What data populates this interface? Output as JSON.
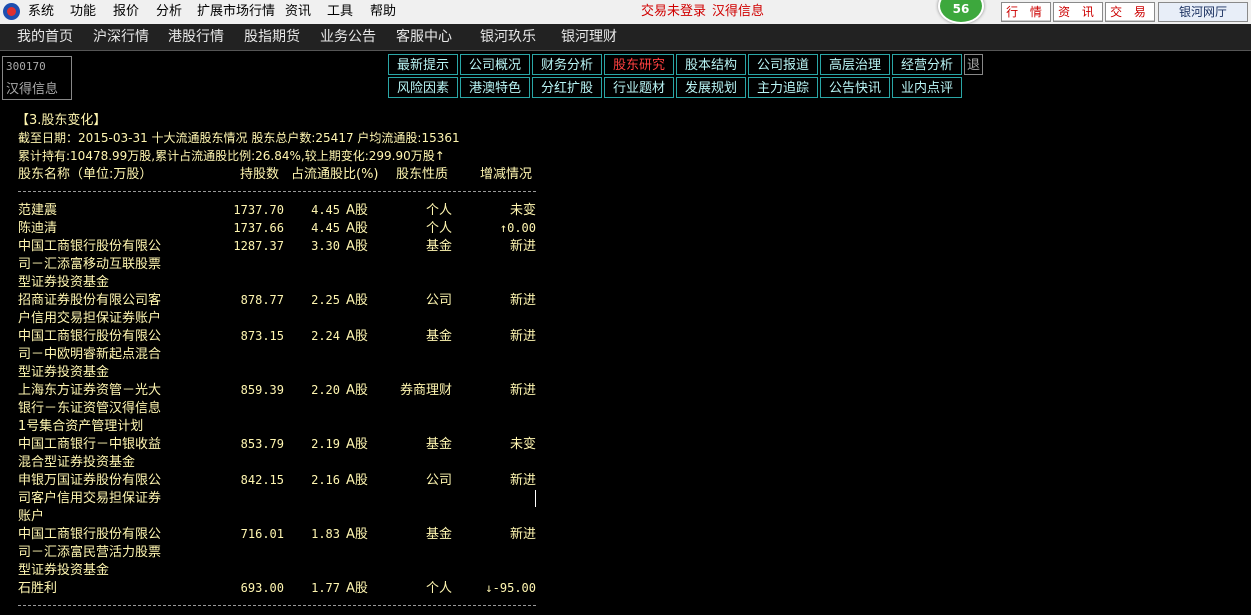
{
  "menubar": {
    "items": [
      "系统",
      "功能",
      "报价",
      "分析",
      "扩展市场行情",
      "资讯",
      "工具",
      "帮助"
    ],
    "status_login": "交易未登录",
    "status_stock": "汉得信息",
    "badge": "56",
    "buttons": [
      "行 情",
      "资 讯",
      "交 易"
    ],
    "hall_button": "银河网厅"
  },
  "navbar": {
    "items": [
      "我的首页",
      "沪深行情",
      "港股行情",
      "股指期货",
      "业务公告",
      "客服中心",
      "银河玖乐",
      "银河理财"
    ]
  },
  "stock": {
    "code": "300170",
    "name": "汉得信息"
  },
  "tabs": {
    "row1": [
      "最新提示",
      "公司概况",
      "财务分析",
      "股东研究",
      "股本结构",
      "公司报道",
      "高层治理",
      "经营分析"
    ],
    "row2": [
      "风险因素",
      "港澳特色",
      "分红扩股",
      "行业题材",
      "发展规划",
      "主力追踪",
      "公告快讯",
      "业内点评"
    ],
    "active": "股东研究",
    "exit": "退"
  },
  "content": {
    "section_title": "【3.股东变化】",
    "line1": "截至日期：2015-03-31 十大流通股东情况 股东总户数:25417 户均流通股:15361",
    "line2": "累计持有:10478.99万股,累计占流通股比例:26.84%,较上期变化:299.90万股",
    "line2_arrow": "↑",
    "headers": [
      "股东名称（单位:万股）",
      "持股数",
      "占流通股比(%)",
      "股东性质",
      "增减情况"
    ],
    "rows": [
      {
        "name": [
          "范建震"
        ],
        "shares": "1737.70",
        "ratio": "4.45",
        "type": "A股",
        "nature": "个人",
        "change": "未变"
      },
      {
        "name": [
          "陈迪清"
        ],
        "shares": "1737.66",
        "ratio": "4.45",
        "type": "A股",
        "nature": "个人",
        "change": "↑0.00"
      },
      {
        "name": [
          "中国工商银行股份有限公",
          "司－汇添富移动互联股票",
          "型证券投资基金"
        ],
        "shares": "1287.37",
        "ratio": "3.30",
        "type": "A股",
        "nature": "基金",
        "change": "新进"
      },
      {
        "name": [
          "招商证券股份有限公司客",
          "户信用交易担保证券账户"
        ],
        "shares": "878.77",
        "ratio": "2.25",
        "type": "A股",
        "nature": "公司",
        "change": "新进"
      },
      {
        "name": [
          "中国工商银行股份有限公",
          "司－中欧明睿新起点混合",
          "型证券投资基金"
        ],
        "shares": "873.15",
        "ratio": "2.24",
        "type": "A股",
        "nature": "基金",
        "change": "新进"
      },
      {
        "name": [
          "上海东方证券资管－光大",
          "银行－东证资管汉得信息",
          "1号集合资产管理计划"
        ],
        "shares": "859.39",
        "ratio": "2.20",
        "type": "A股",
        "nature": "券商理财",
        "change": "新进"
      },
      {
        "name": [
          "中国工商银行－中银收益",
          "混合型证券投资基金"
        ],
        "shares": "853.79",
        "ratio": "2.19",
        "type": "A股",
        "nature": "基金",
        "change": "未变"
      },
      {
        "name": [
          "申银万国证券股份有限公",
          "司客户信用交易担保证券",
          "账户"
        ],
        "shares": "842.15",
        "ratio": "2.16",
        "type": "A股",
        "nature": "公司",
        "change": "新进"
      },
      {
        "name": [
          "中国工商银行股份有限公",
          "司－汇添富民营活力股票",
          "型证券投资基金"
        ],
        "shares": "716.01",
        "ratio": "1.83",
        "type": "A股",
        "nature": "基金",
        "change": "新进"
      },
      {
        "name": [
          "石胜利"
        ],
        "shares": "693.00",
        "ratio": "1.77",
        "type": "A股",
        "nature": "个人",
        "change": "↓-95.00"
      }
    ]
  }
}
